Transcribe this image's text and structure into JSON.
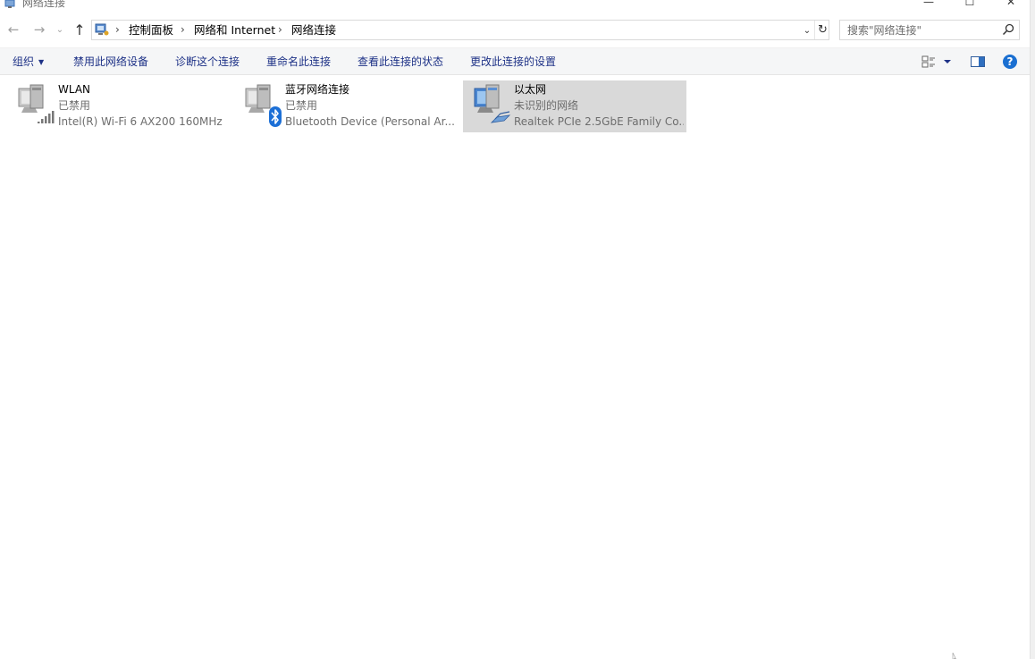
{
  "window": {
    "title": "网络连接",
    "minimize_glyph": "—",
    "maximize_glyph": "☐",
    "close_glyph": "✕"
  },
  "nav": {
    "back_glyph": "←",
    "forward_glyph": "→",
    "recent_glyph": "⌄",
    "up_glyph": "↑"
  },
  "address": {
    "breadcrumbs": [
      "控制面板",
      "网络和 Internet",
      "网络连接"
    ],
    "separator": "›",
    "dropdown_glyph": "⌄",
    "refresh_glyph": "↻"
  },
  "search": {
    "placeholder": "搜索\"网络连接\""
  },
  "commands": {
    "organize": "组织",
    "disable": "禁用此网络设备",
    "diagnose": "诊断这个连接",
    "rename": "重命名此连接",
    "view_status": "查看此连接的状态",
    "change_settings": "更改此连接的设置"
  },
  "connections": [
    {
      "name": "WLAN",
      "status": "已禁用",
      "device": "Intel(R) Wi-Fi 6 AX200 160MHz",
      "icon": "wifi-adapter-icon",
      "selected": false
    },
    {
      "name": "蓝牙网络连接",
      "status": "已禁用",
      "device": "Bluetooth Device (Personal Ar...",
      "icon": "bluetooth-adapter-icon",
      "selected": false
    },
    {
      "name": "以太网",
      "status": "未识别的网络",
      "device": "Realtek PCIe 2.5GbE Family Co...",
      "icon": "ethernet-adapter-icon",
      "selected": true
    }
  ],
  "colors": {
    "command_text": "#1e3287",
    "selection": "#d9d9d9",
    "secondary_text": "#6d6d6d",
    "help_blue": "#1a6fd1",
    "bluetooth_blue": "#1c6fd6"
  }
}
